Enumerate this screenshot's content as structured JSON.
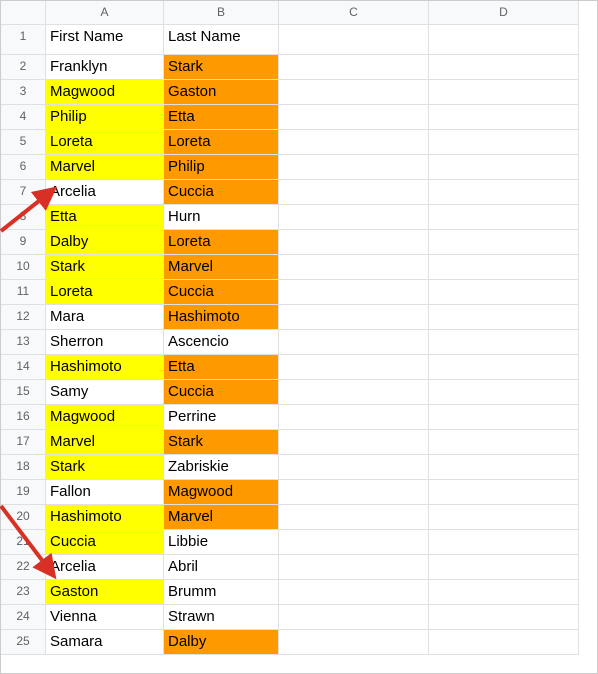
{
  "columns": [
    "A",
    "B",
    "C",
    "D"
  ],
  "rows": [
    {
      "n": 1,
      "a": "First Name",
      "b": "Last Name",
      "ha": "",
      "hb": ""
    },
    {
      "n": 2,
      "a": "Franklyn",
      "b": "Stark",
      "ha": "",
      "hb": "hl-orange"
    },
    {
      "n": 3,
      "a": "Magwood",
      "b": "Gaston",
      "ha": "hl-yellow",
      "hb": "hl-orange"
    },
    {
      "n": 4,
      "a": "Philip",
      "b": "Etta",
      "ha": "hl-yellow",
      "hb": "hl-orange"
    },
    {
      "n": 5,
      "a": "Loreta",
      "b": "Loreta",
      "ha": "hl-yellow",
      "hb": "hl-orange"
    },
    {
      "n": 6,
      "a": "Marvel",
      "b": "Philip",
      "ha": "hl-yellow",
      "hb": "hl-orange"
    },
    {
      "n": 7,
      "a": "Arcelia",
      "b": "Cuccia",
      "ha": "",
      "hb": "hl-orange"
    },
    {
      "n": 8,
      "a": "Etta",
      "b": "Hurn",
      "ha": "hl-yellow",
      "hb": ""
    },
    {
      "n": 9,
      "a": "Dalby",
      "b": "Loreta",
      "ha": "hl-yellow",
      "hb": "hl-orange"
    },
    {
      "n": 10,
      "a": "Stark",
      "b": "Marvel",
      "ha": "hl-yellow",
      "hb": "hl-orange"
    },
    {
      "n": 11,
      "a": "Loreta",
      "b": "Cuccia",
      "ha": "hl-yellow",
      "hb": "hl-orange"
    },
    {
      "n": 12,
      "a": "Mara",
      "b": "Hashimoto",
      "ha": "",
      "hb": "hl-orange"
    },
    {
      "n": 13,
      "a": "Sherron",
      "b": "Ascencio",
      "ha": "",
      "hb": ""
    },
    {
      "n": 14,
      "a": "Hashimoto",
      "b": "Etta",
      "ha": "hl-yellow",
      "hb": "hl-orange"
    },
    {
      "n": 15,
      "a": "Samy",
      "b": "Cuccia",
      "ha": "",
      "hb": "hl-orange"
    },
    {
      "n": 16,
      "a": "Magwood",
      "b": "Perrine",
      "ha": "hl-yellow",
      "hb": ""
    },
    {
      "n": 17,
      "a": "Marvel",
      "b": "Stark",
      "ha": "hl-yellow",
      "hb": "hl-orange"
    },
    {
      "n": 18,
      "a": "Stark",
      "b": "Zabriskie",
      "ha": "hl-yellow",
      "hb": ""
    },
    {
      "n": 19,
      "a": "Fallon",
      "b": "Magwood",
      "ha": "",
      "hb": "hl-orange"
    },
    {
      "n": 20,
      "a": "Hashimoto",
      "b": "Marvel",
      "ha": "hl-yellow",
      "hb": "hl-orange"
    },
    {
      "n": 21,
      "a": "Cuccia",
      "b": "Libbie",
      "ha": "hl-yellow",
      "hb": ""
    },
    {
      "n": 22,
      "a": "Arcelia",
      "b": "Abril",
      "ha": "",
      "hb": ""
    },
    {
      "n": 23,
      "a": "Gaston",
      "b": "Brumm",
      "ha": "hl-yellow",
      "hb": ""
    },
    {
      "n": 24,
      "a": "Vienna",
      "b": "Strawn",
      "ha": "",
      "hb": ""
    },
    {
      "n": 25,
      "a": "Samara",
      "b": "Dalby",
      "ha": "",
      "hb": "hl-orange"
    }
  ]
}
